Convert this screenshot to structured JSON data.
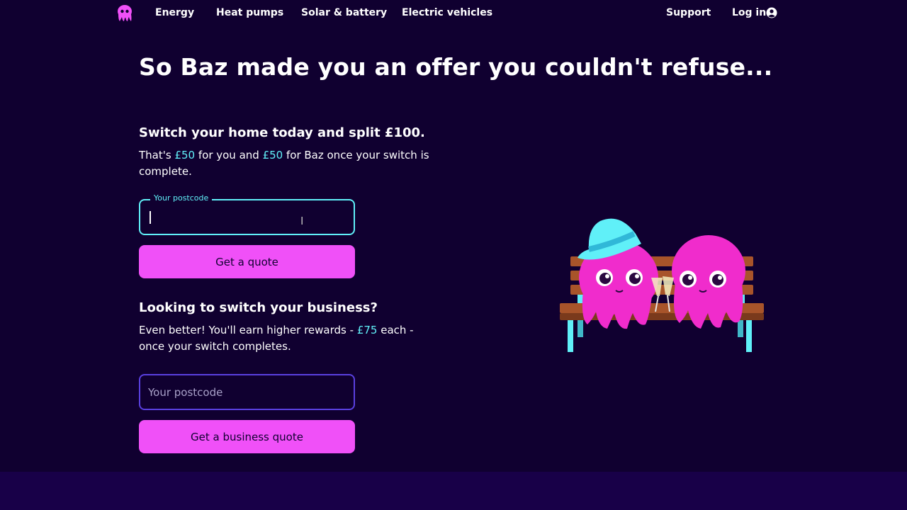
{
  "nav": {
    "links": [
      "Energy",
      "Heat pumps",
      "Solar & battery",
      "Electric vehicles"
    ],
    "support": "Support",
    "login": "Log in",
    "icons": {
      "logo": "octopus-logo-icon",
      "login": "user-icon"
    }
  },
  "headline": "So Baz made you an offer you couldn't refuse...",
  "home": {
    "title": "Switch your home today and split £100.",
    "text_1": "That's ",
    "amount_1": "£50",
    "text_2": " for you and ",
    "amount_2": "£50",
    "text_3": " for Baz once your switch is complete.",
    "postcode_label": "Your postcode",
    "postcode_value": "",
    "button": "Get a quote"
  },
  "business": {
    "title": "Looking to switch your business?",
    "text_1": "Even better! You'll earn higher rewards - ",
    "amount": "£75",
    "text_2": " each - once your switch completes.",
    "postcode_placeholder": "Your postcode",
    "postcode_value": "",
    "button": "Get a business quote"
  },
  "colors": {
    "background": "#100030",
    "accent_pink": "#f050f8",
    "accent_cyan": "#60f0f8",
    "footer_band": "#180048"
  }
}
